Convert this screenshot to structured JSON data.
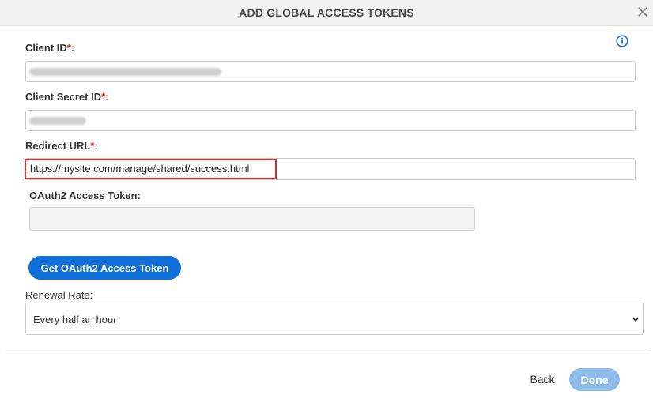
{
  "dialog": {
    "title": "ADD GLOBAL ACCESS TOKENS",
    "close_icon": "close-icon",
    "info_icon": "info-icon"
  },
  "form": {
    "client_id": {
      "label": "Client ID",
      "required_marker": "*",
      "suffix": ":"
    },
    "client_secret": {
      "label": "Client Secret ID",
      "required_marker": "*",
      "suffix": ":"
    },
    "redirect_url": {
      "label": "Redirect URL",
      "required_marker": "*",
      "suffix": ":",
      "value": "https://mysite.com/manage/shared/success.html"
    },
    "oauth_token": {
      "label": "OAuth2 Access Token:",
      "value": ""
    },
    "get_token_button": "Get OAuth2 Access Token",
    "renewal_rate": {
      "label": "Renewal Rate:",
      "selected": "Every half an hour"
    }
  },
  "footer": {
    "back_label": "Back",
    "done_label": "Done"
  },
  "colors": {
    "header_bg": "#f2f2f2",
    "required": "#e01b1b",
    "primary_button": "#1070d8",
    "done_disabled": "#8fbde9",
    "highlight_border": "#d32f2f",
    "info_icon": "#1070d8"
  }
}
